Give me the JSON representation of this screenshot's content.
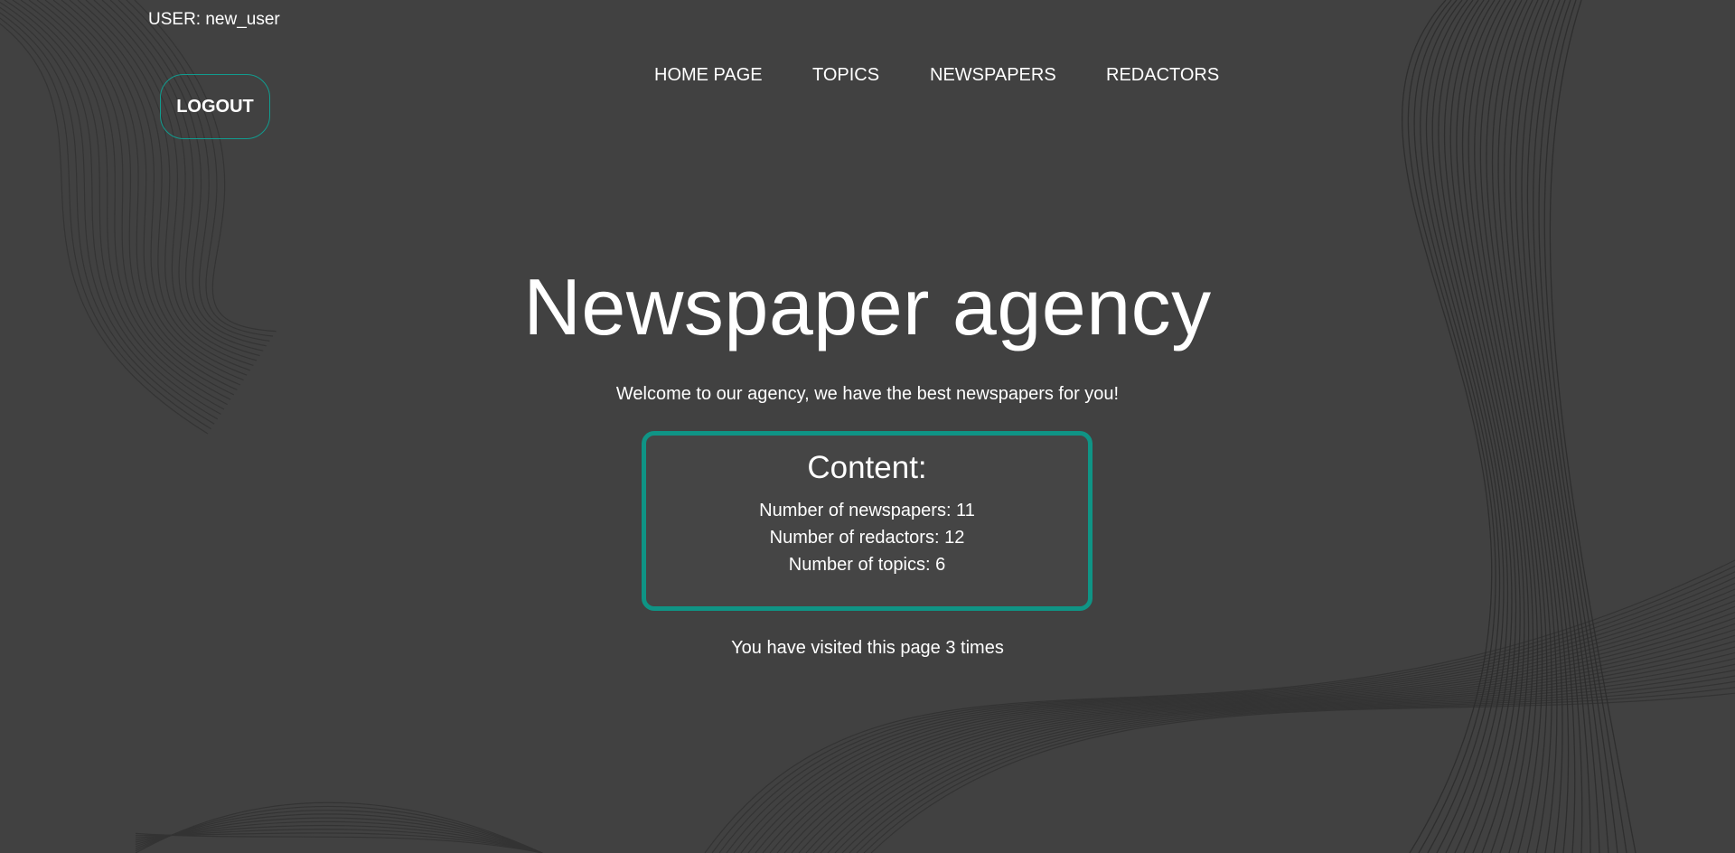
{
  "header": {
    "user_label": "USER: new_user",
    "logout_label": "LOGOUT"
  },
  "nav": {
    "items": [
      {
        "label": "HOME PAGE"
      },
      {
        "label": "TOPICS"
      },
      {
        "label": "NEWSPAPERS"
      },
      {
        "label": "REDACTORS"
      }
    ]
  },
  "main": {
    "title": "Newspaper agency",
    "welcome": "Welcome to our agency, we have the best newspapers for you!",
    "content": {
      "title": "Content:",
      "newspapers": "Number of newspapers: 11",
      "redactors": "Number of redactors: 12",
      "topics": "Number of topics: 6"
    },
    "visits": "You have visited this page 3 times"
  },
  "colors": {
    "background": "#414141",
    "accent": "#0f9485",
    "text": "#ffffff"
  }
}
